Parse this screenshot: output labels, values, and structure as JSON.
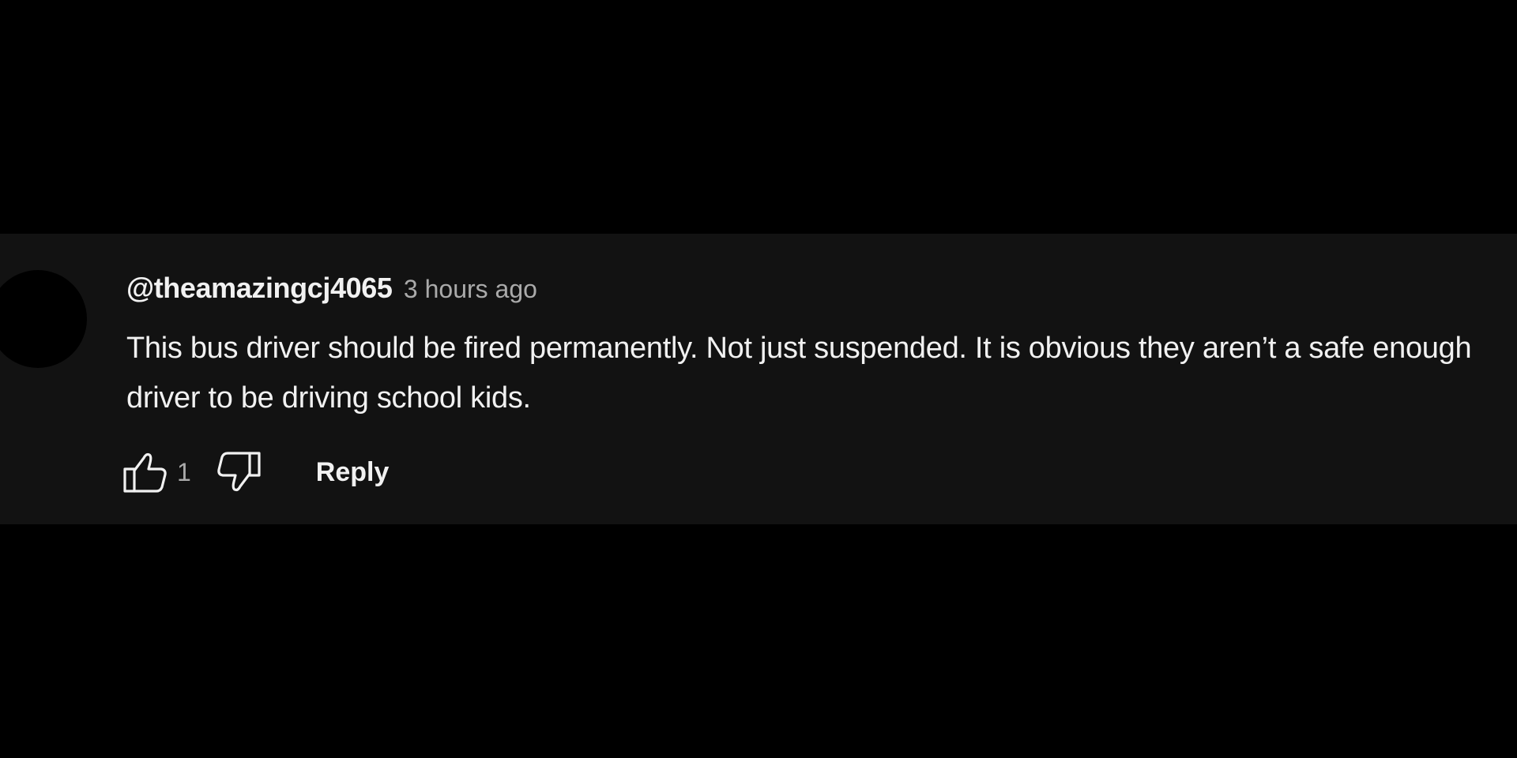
{
  "comment": {
    "author": "@theamazingcj4065",
    "timestamp": "3 hours ago",
    "text": "This bus driver should be fired permanently. Not just suspended. It is obvious they aren’t a safe enough driver to be driving school kids.",
    "like_count": "1",
    "reply_label": "Reply"
  },
  "icons": {
    "like": "thumbs-up-icon",
    "dislike": "thumbs-down-icon"
  },
  "colors": {
    "page_background": "#000000",
    "panel_background": "#121212",
    "primary_text": "#f1f1f1",
    "secondary_text": "#aaaaaa"
  }
}
